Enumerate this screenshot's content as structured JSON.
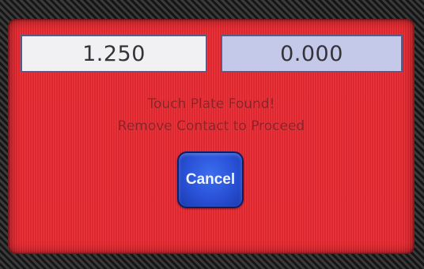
{
  "screen": {
    "background_color": "#ec2b33"
  },
  "readouts": {
    "left_value": "1.250",
    "right_value": "0.000"
  },
  "message": {
    "line1": "Touch Plate Found!",
    "line2": "Remove Contact to Proceed"
  },
  "actions": {
    "cancel_label": "Cancel",
    "cancel_color": "#2951d6"
  }
}
